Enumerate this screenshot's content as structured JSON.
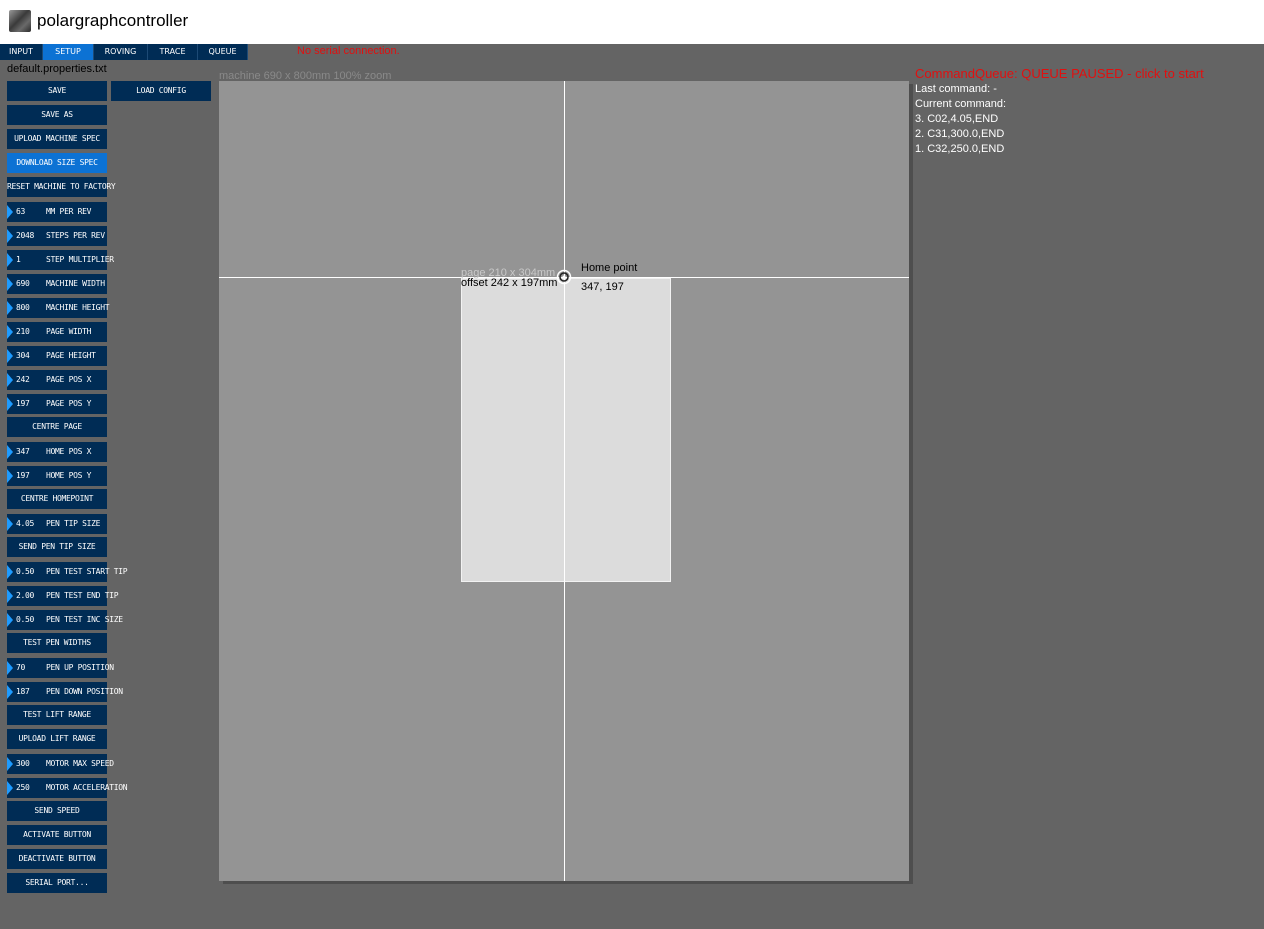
{
  "window": {
    "title": "polargraphcontroller"
  },
  "tabs": [
    {
      "label": "INPUT"
    },
    {
      "label": "SETUP"
    },
    {
      "label": "ROVING"
    },
    {
      "label": "TRACE"
    },
    {
      "label": "QUEUE"
    }
  ],
  "active_tab": "SETUP",
  "serial_status": "No serial connection.",
  "properties_file": "default.properties.txt",
  "buttons": {
    "save": "SAVE",
    "load_config": "LOAD CONFIG",
    "save_as": "SAVE AS",
    "upload_machine_spec": "UPLOAD MACHINE SPEC",
    "download_size_spec": "DOWNLOAD SIZE SPEC",
    "reset_machine": "RESET MACHINE TO FACTORY",
    "centre_page": "CENTRE PAGE",
    "centre_homepoint": "CENTRE HOMEPOINT",
    "send_pen_tip_size": "SEND PEN TIP SIZE",
    "test_pen_widths": "TEST PEN WIDTHS",
    "test_lift_range": "TEST LIFT RANGE",
    "upload_lift_range": "UPLOAD LIFT RANGE",
    "send_speed": "SEND SPEED",
    "activate_button": "ACTIVATE BUTTON",
    "deactivate_button": "DEACTIVATE BUTTON",
    "serial_port": "SERIAL PORT..."
  },
  "fields": {
    "mm_per_rev": {
      "value": "63",
      "label": "MM PER REV"
    },
    "steps_per_rev": {
      "value": "2048",
      "label": "STEPS PER REV"
    },
    "step_multiplier": {
      "value": "1",
      "label": "STEP MULTIPLIER"
    },
    "machine_width": {
      "value": "690",
      "label": "MACHINE WIDTH"
    },
    "machine_height": {
      "value": "800",
      "label": "MACHINE HEIGHT"
    },
    "page_width": {
      "value": "210",
      "label": "PAGE WIDTH"
    },
    "page_height": {
      "value": "304",
      "label": "PAGE HEIGHT"
    },
    "page_pos_x": {
      "value": "242",
      "label": "PAGE POS X"
    },
    "page_pos_y": {
      "value": "197",
      "label": "PAGE POS Y"
    },
    "home_pos_x": {
      "value": "347",
      "label": "HOME POS X"
    },
    "home_pos_y": {
      "value": "197",
      "label": "HOME POS Y"
    },
    "pen_tip_size": {
      "value": "4.05",
      "label": "PEN TIP SIZE"
    },
    "pen_test_start_tip": {
      "value": "0.50",
      "label": "PEN TEST START TIP"
    },
    "pen_test_end_tip": {
      "value": "2.00",
      "label": "PEN TEST END TIP"
    },
    "pen_test_inc_size": {
      "value": "0.50",
      "label": "PEN TEST INC SIZE"
    },
    "pen_up_position": {
      "value": "70",
      "label": "PEN UP POSITION"
    },
    "pen_down_position": {
      "value": "187",
      "label": "PEN DOWN POSITION"
    },
    "motor_max_speed": {
      "value": "300",
      "label": "MOTOR MAX SPEED"
    },
    "motor_acceleration": {
      "value": "250",
      "label": "MOTOR ACCELERATION"
    }
  },
  "canvas": {
    "machine_label": "machine 690 x 800mm 100% zoom",
    "page_label": "page 210 x 304mm",
    "offset_label": "offset 242 x 197mm",
    "home_label": "Home point",
    "home_coords": "347, 197"
  },
  "command_queue": {
    "title": "CommandQueue: QUEUE PAUSED - click to start",
    "last_command": "Last command: -",
    "current_command": "Current command:",
    "items": [
      "3. C02,4.05,END",
      "2. C31,300.0,END",
      "1. C32,250.0,END"
    ]
  },
  "colors": {
    "background": "#646464",
    "button": "#002c55",
    "button_active": "#0c72d4",
    "machine_area": "#949494",
    "page_area": "#dcdcdc",
    "alert": "#e01010"
  }
}
